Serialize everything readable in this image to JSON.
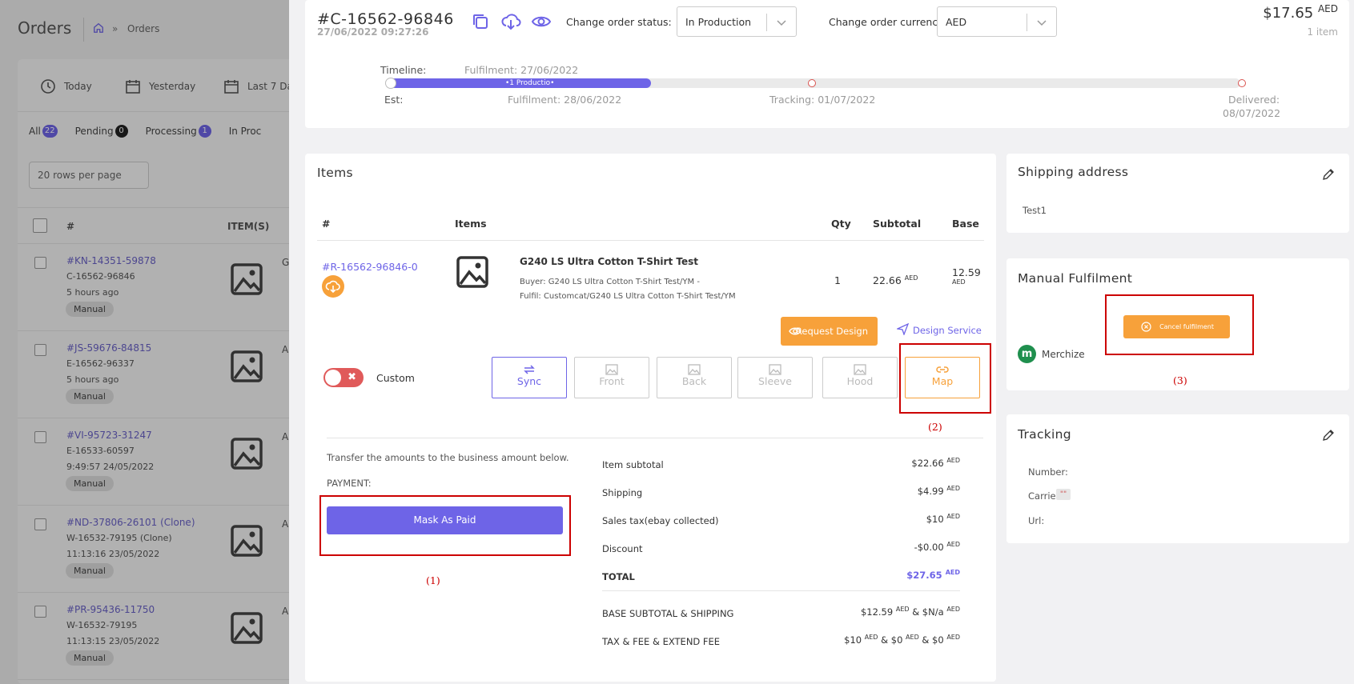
{
  "background": {
    "title": "Orders",
    "breadcrumb": "Orders",
    "breadcrumb_sep": "»",
    "date_filters": [
      "Today",
      "Yesterday",
      "Last 7 Da"
    ],
    "tabs": [
      {
        "label": "All",
        "count": "22",
        "color": "#6e64e7"
      },
      {
        "label": "Pending",
        "count": "0",
        "color": "#222222"
      },
      {
        "label": "Processing",
        "count": "1",
        "color": "#6e64e7"
      },
      {
        "label": "In Proc",
        "count": "",
        "color": ""
      }
    ],
    "rows_per_page": "20 rows per page",
    "columns": {
      "number": "#",
      "items": "ITEM(S)"
    },
    "orders": [
      {
        "id": "#KN-14351-59878",
        "ref": "C-16562-96846",
        "time": "5 hours ago",
        "tag": "Manual",
        "trunc": "G"
      },
      {
        "id": "#JS-59676-84815",
        "ref": "E-16562-96337",
        "time": "5 hours ago",
        "tag": "Manual",
        "trunc": "A"
      },
      {
        "id": "#VI-95723-31247",
        "ref": "E-16533-60597",
        "time": "9:49:57 24/05/2022",
        "tag": "Manual",
        "trunc": "A"
      },
      {
        "id": "#ND-37806-26101 (Clone)",
        "ref": "W-16532-79195 (Clone)",
        "time": "11:13:16 23/05/2022",
        "tag": "Manual",
        "trunc": "A"
      },
      {
        "id": "#PR-95436-11750",
        "ref": "W-16532-79195",
        "time": "11:13:15 23/05/2022",
        "tag": "Manual",
        "trunc": "A"
      }
    ]
  },
  "header": {
    "order_id": "#C-16562-96846",
    "order_date": "27/06/2022 09:27:26",
    "status_label": "Change order status:",
    "status_value": "In Production",
    "currency_label": "Change order currency:",
    "currency_value": "AED",
    "total": "$17.65",
    "total_currency": "AED",
    "items_count": "1 item"
  },
  "timeline": {
    "label": "Timeline:",
    "actual_fulfilment": "Fulfilment: 27/06/2022",
    "progress_text": "•1 Productio•",
    "progress": 0.31,
    "est_label": "Est:",
    "est_fulfilment": "Fulfilment: 28/06/2022",
    "est_tracking": "Tracking: 01/07/2022",
    "est_delivered_label": "Delivered:",
    "est_delivered_date": "08/07/2022"
  },
  "items": {
    "title": "Items",
    "columns": {
      "number": "#",
      "items": "Items",
      "qty": "Qty",
      "subtotal": "Subtotal",
      "base": "Base"
    },
    "row": {
      "id": "#R-16562-96846-0",
      "name": "G240 LS Ultra Cotton T-Shirt Test",
      "buyer": "Buyer: G240 LS Ultra Cotton T-Shirt Test/YM -",
      "fulfil": "Fulfil: Customcat/G240 LS Ultra Cotton T-Shirt Test/YM",
      "qty": "1",
      "subtotal": "22.66",
      "subtotal_currency": "AED",
      "base": "12.59",
      "base_currency": "AED"
    },
    "request_design": "Request Design",
    "design_service": "Design Service",
    "custom_label": "Custom",
    "view_buttons": [
      "Sync",
      "Front",
      "Back",
      "Sleeve",
      "Hood",
      "Map"
    ],
    "transfer_note": "Transfer the amounts to the business amount below.",
    "payment_label": "PAYMENT:",
    "mark_paid": "Mask As Paid",
    "summary": [
      {
        "label": "Item subtotal",
        "value": "$22.66",
        "cur": "AED"
      },
      {
        "label": "Shipping",
        "value": "$4.99",
        "cur": "AED"
      },
      {
        "label": "Sales tax(ebay collected)",
        "value": "$10",
        "cur": "AED"
      },
      {
        "label": "Discount",
        "value": "-$0.00",
        "cur": "AED"
      },
      {
        "label": "TOTAL",
        "value": "$27.65",
        "cur": "AED"
      }
    ],
    "base_label": "BASE SUBTOTAL & SHIPPING",
    "base_value_1": "$12.59",
    "base_value_2": "& $N/a",
    "fees_label": "TAX & FEE & EXTEND FEE",
    "fees_value_1": "$10",
    "fees_value_2": "& $0",
    "fees_value_3": "& $0",
    "currency": "AED"
  },
  "annotations": {
    "one": "(1)",
    "two": "(2)",
    "three": "(3)"
  },
  "shipping": {
    "title": "Shipping address",
    "name": "Test1"
  },
  "manual": {
    "title": "Manual Fulfilment",
    "cancel": "Cancel fulfilment",
    "provider": "Merchize",
    "provider_logo": "m"
  },
  "tracking": {
    "title": "Tracking",
    "number": "Number:",
    "carrier": "Carrier:",
    "carrier_value": "\"\"",
    "url": "Url:"
  }
}
